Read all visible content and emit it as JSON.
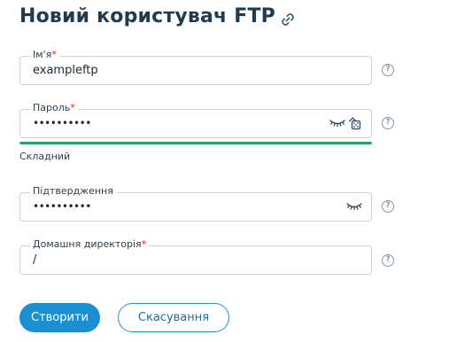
{
  "page": {
    "title": "Новий користувач FTP"
  },
  "form": {
    "username": {
      "label": "Ім'я",
      "required_mark": "*",
      "value": "exampleftp"
    },
    "password": {
      "label": "Пароль",
      "required_mark": "*",
      "value_masked": "••••••••••",
      "strength_text": "Складний",
      "strength_fraction": 1.0,
      "strength_color": "#21a365"
    },
    "confirm": {
      "label": "Підтвердження",
      "value_masked": "••••••••••"
    },
    "home_dir": {
      "label": "Домашня директорія",
      "required_mark": "*",
      "value": "/"
    },
    "help_glyph": "?"
  },
  "actions": {
    "create_label": "Створити",
    "cancel_label": "Скасування"
  },
  "icons": {
    "title_link": "link-icon",
    "show_password": "eye-closed-icon",
    "generate_password": "dice-icon",
    "help": "help-icon"
  },
  "colors": {
    "accent": "#1a8fd1",
    "required": "#dd2222",
    "strength_good": "#21a365"
  }
}
